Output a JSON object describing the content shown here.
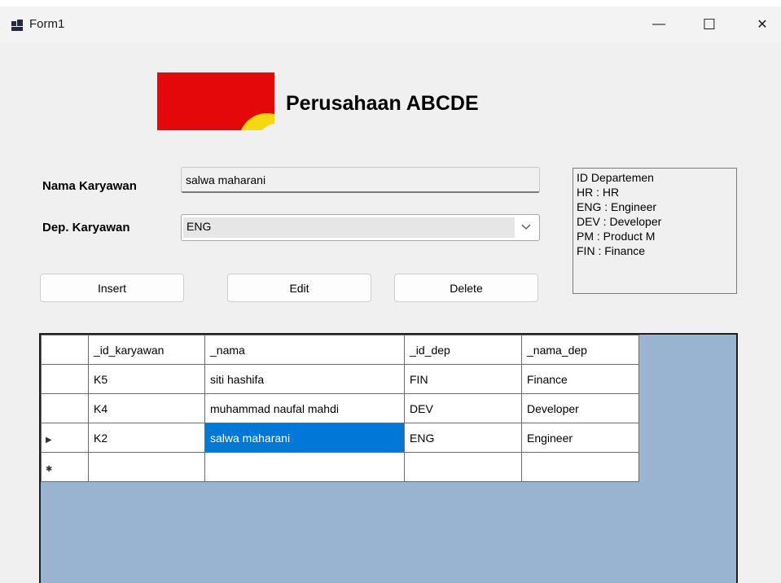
{
  "window": {
    "title": "Form1",
    "minimize_glyph": "—",
    "maximize_glyph": "☐",
    "close_glyph": "✕"
  },
  "header": {
    "company_name": "Perusahaan ABCDE"
  },
  "form": {
    "name_label": "Nama Karyawan",
    "name_value": "salwa maharani",
    "dept_label": "Dep. Karyawan",
    "dept_value": "ENG"
  },
  "dept_list": [
    "ID Departemen",
    "HR : HR",
    "ENG : Engineer",
    "DEV : Developer",
    "PM : Product M",
    "FIN : Finance"
  ],
  "buttons": {
    "insert": "Insert",
    "edit": "Edit",
    "delete": "Delete"
  },
  "grid": {
    "columns": [
      "_id_karyawan",
      "_nama",
      "_id_dep",
      "_nama_dep"
    ],
    "rows": [
      {
        "marker": "",
        "cells": [
          "K5",
          "siti hashifa",
          "FIN",
          "Finance"
        ]
      },
      {
        "marker": "",
        "cells": [
          "K4",
          "muhammad naufal mahdi",
          "DEV",
          "Developer"
        ]
      },
      {
        "marker": "▶",
        "cells": [
          "K2",
          "salwa maharani",
          "ENG",
          "Engineer"
        ]
      },
      {
        "marker": "✱",
        "cells": [
          "",
          "",
          "",
          ""
        ]
      }
    ],
    "selected": {
      "row": 2,
      "col": 1
    }
  },
  "colors": {
    "grid_background": "#99b4d1",
    "selection": "#0078d7",
    "logo_red": "#e4080a",
    "logo_yellow": "#f5d80e"
  }
}
